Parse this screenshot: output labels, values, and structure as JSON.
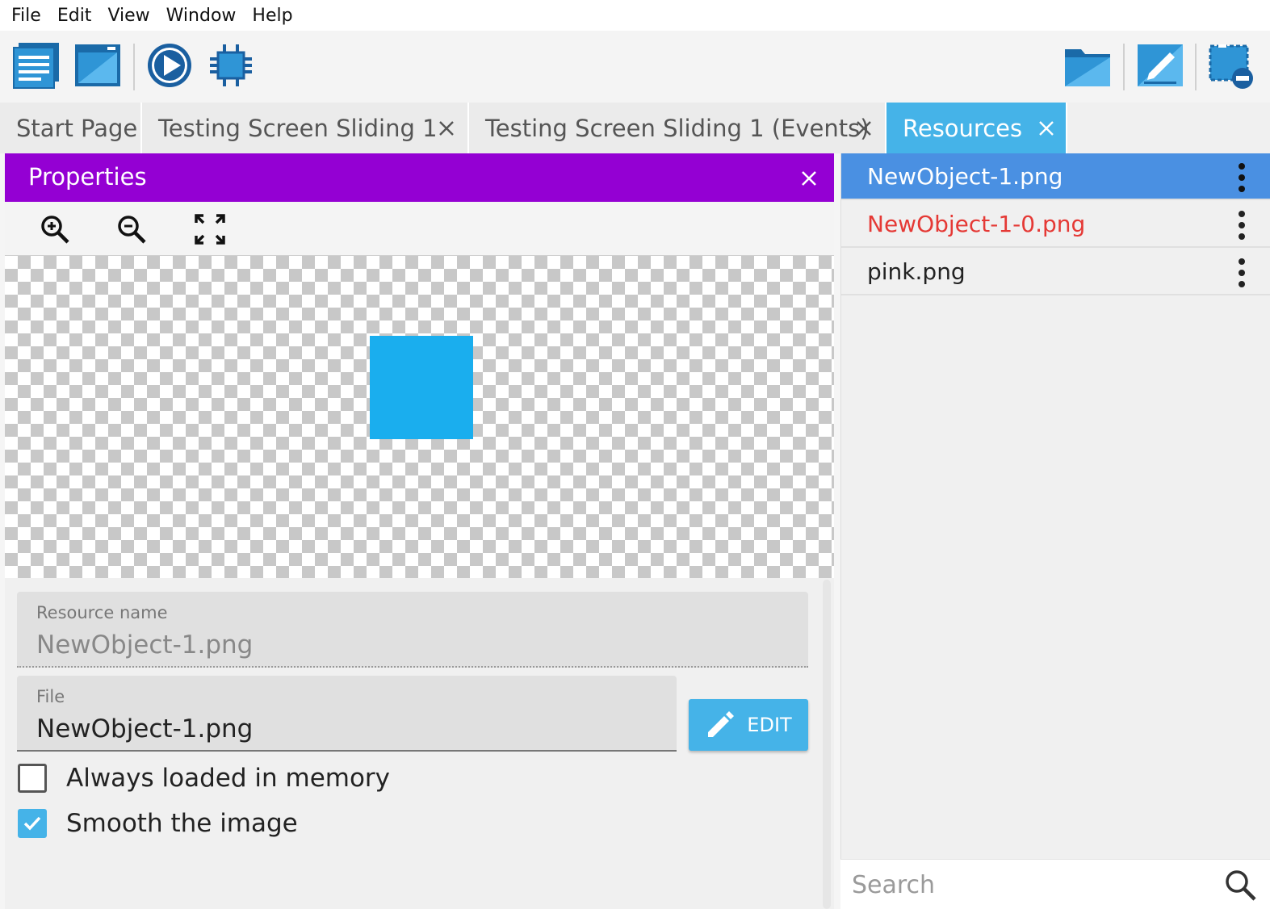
{
  "menubar": {
    "items": [
      "File",
      "Edit",
      "View",
      "Window",
      "Help"
    ]
  },
  "toolbar": {
    "left_icons": [
      "project-manager-icon",
      "scene-editor-icon",
      "preview-play-icon",
      "debugger-icon"
    ],
    "right_icons": [
      "open-folder-icon",
      "edit-icon",
      "remove-unused-icon"
    ]
  },
  "tabs": [
    {
      "label": "Start Page",
      "closable": false,
      "active": false
    },
    {
      "label": "Testing Screen Sliding 1",
      "closable": true,
      "active": false
    },
    {
      "label": "Testing Screen Sliding 1 (Events)",
      "closable": true,
      "active": false
    },
    {
      "label": "Resources",
      "closable": true,
      "active": true
    }
  ],
  "properties": {
    "title": "Properties",
    "preview_color": "#1aaeee",
    "resource_name": {
      "label": "Resource name",
      "value": "NewObject-1.png"
    },
    "file": {
      "label": "File",
      "value": "NewObject-1.png"
    },
    "edit_button": "EDIT",
    "checkboxes": [
      {
        "label": "Always loaded in memory",
        "checked": false
      },
      {
        "label": "Smooth the image",
        "checked": true
      }
    ]
  },
  "resources": {
    "items": [
      {
        "name": "NewObject-1.png",
        "selected": true,
        "error": false
      },
      {
        "name": "NewObject-1-0.png",
        "selected": false,
        "error": true
      },
      {
        "name": "pink.png",
        "selected": false,
        "error": false
      }
    ],
    "search_placeholder": "Search"
  },
  "colors": {
    "accent": "#45b3e8",
    "panel_header": "#9400d3",
    "selected_item": "#4a90e2",
    "error_text": "#e53935"
  }
}
